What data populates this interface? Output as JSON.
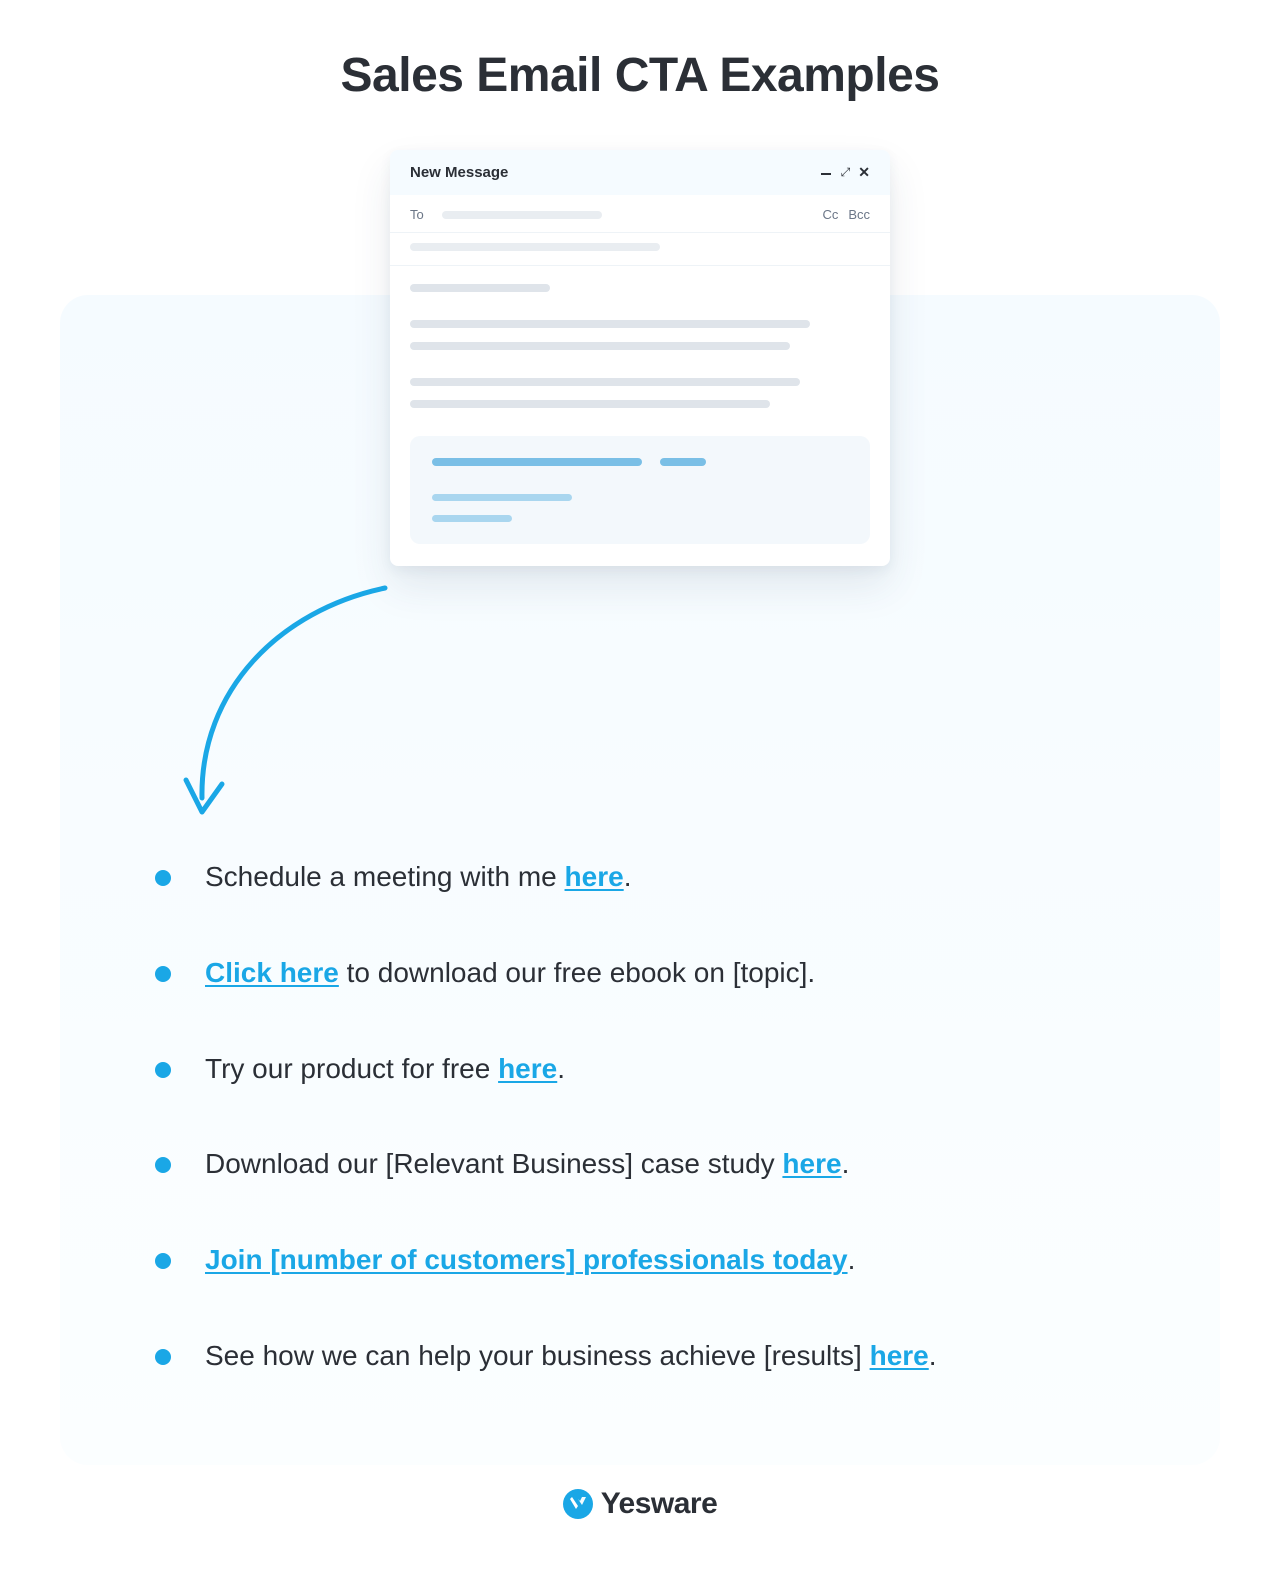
{
  "page": {
    "title": "Sales Email CTA Examples"
  },
  "compose": {
    "header_title": "New Message",
    "to_label": "To",
    "cc_label": "Cc",
    "bcc_label": "Bcc"
  },
  "cta_items": [
    {
      "pre": "Schedule a meeting with me ",
      "link": "here",
      "post": "."
    },
    {
      "pre": "",
      "link": "Click here",
      "post": " to download our free ebook on [topic]."
    },
    {
      "pre": "Try our product for free ",
      "link": "here",
      "post": "."
    },
    {
      "pre": "Download our [Relevant Business] case study ",
      "link": "here",
      "post": "."
    },
    {
      "pre": "",
      "link": "Join [number of customers] professionals today",
      "post": "."
    },
    {
      "pre": "See how we can help your business achieve [results] ",
      "link": "here",
      "post": "."
    }
  ],
  "brand": {
    "name": "Yesware",
    "accent": "#1aa7e6"
  }
}
